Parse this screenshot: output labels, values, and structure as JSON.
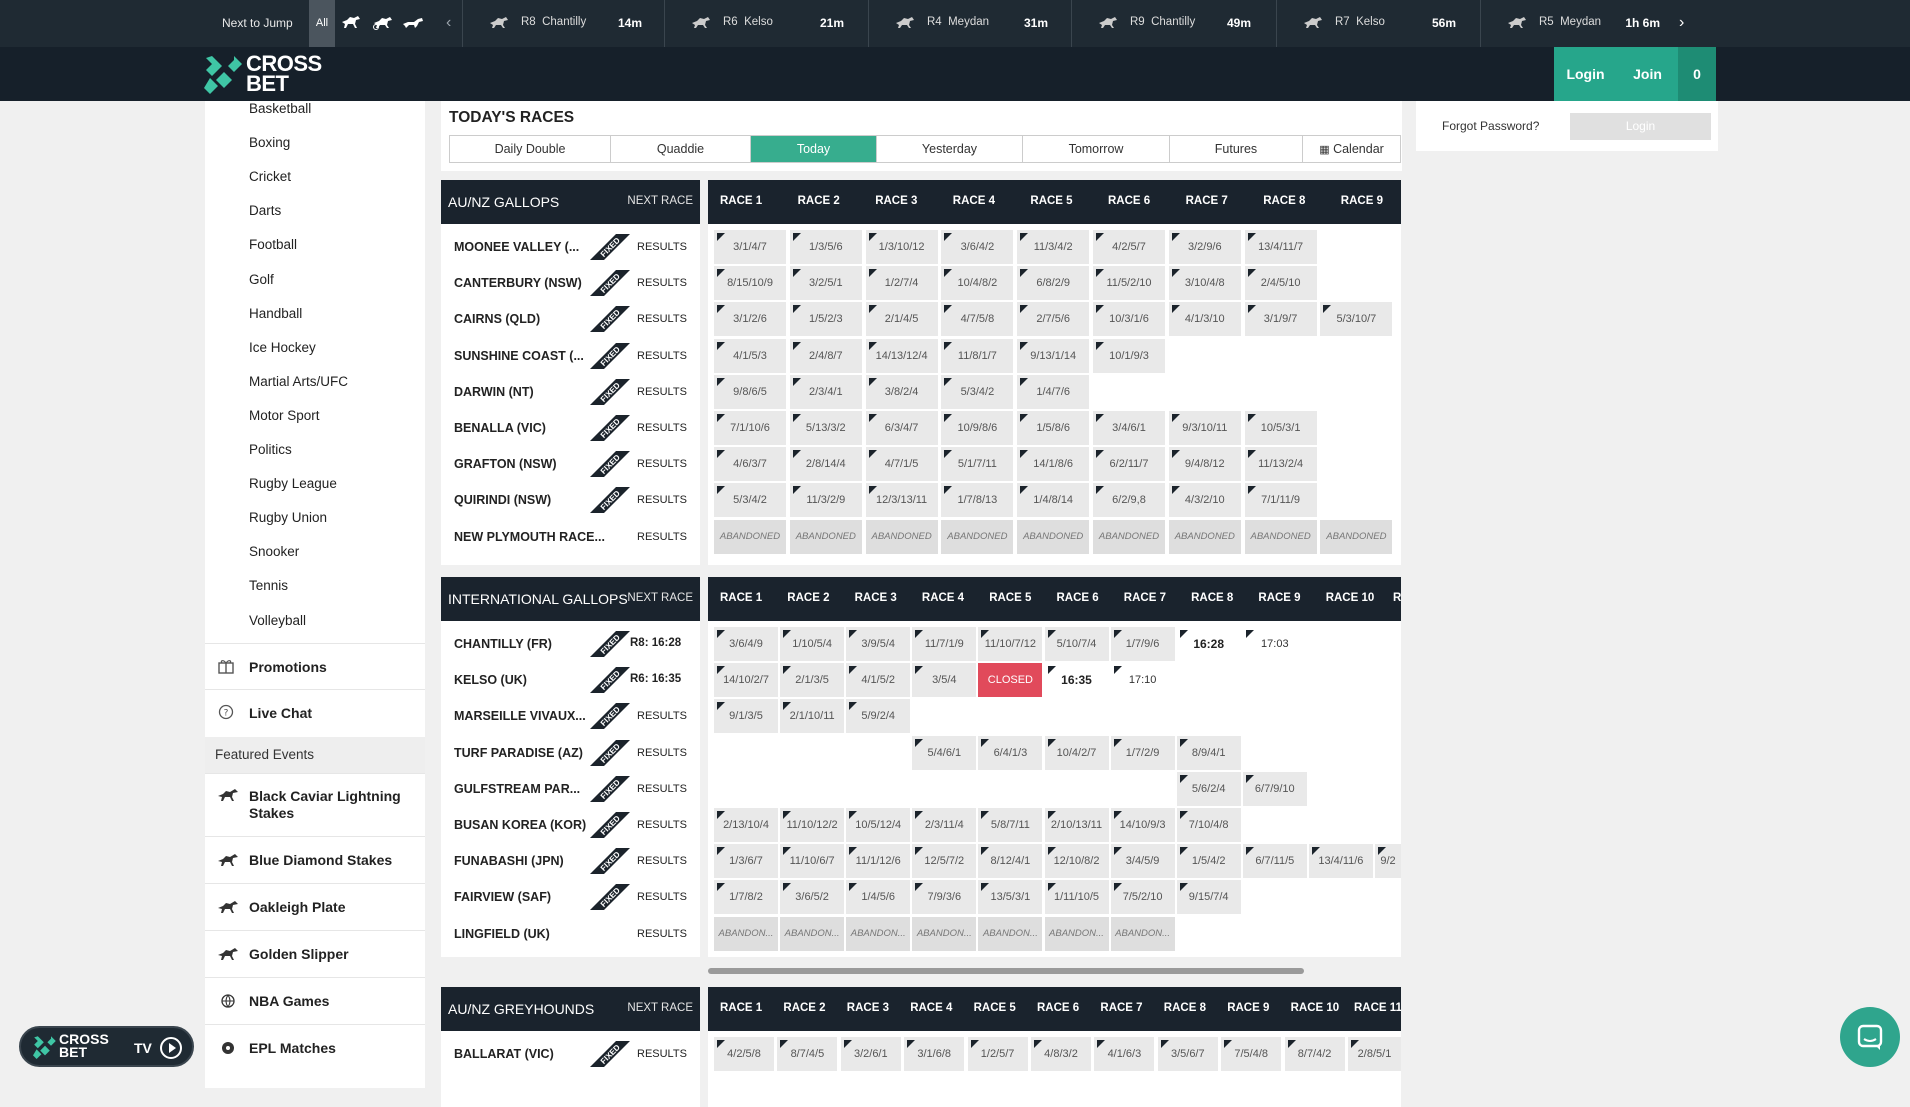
{
  "jumpbar": {
    "next_to_jump": "Next to Jump",
    "all": "All",
    "items": [
      {
        "race": "R8",
        "venue": "Chantilly",
        "time": "14m"
      },
      {
        "race": "R6",
        "venue": "Kelso",
        "time": "21m"
      },
      {
        "race": "R4",
        "venue": "Meydan",
        "time": "31m"
      },
      {
        "race": "R9",
        "venue": "Chantilly",
        "time": "49m"
      },
      {
        "race": "R7",
        "venue": "Kelso",
        "time": "56m"
      },
      {
        "race": "R5",
        "venue": "Meydan",
        "time": "1h 6m"
      }
    ]
  },
  "header": {
    "logo_line1": "CROSS",
    "logo_line2": "BET",
    "login": "Login",
    "join": "Join",
    "bet_count": "0"
  },
  "login_panel": {
    "forgot": "Forgot Password?",
    "login": "Login"
  },
  "sidebar": {
    "sports": [
      "Basketball",
      "Boxing",
      "Cricket",
      "Darts",
      "Football",
      "Golf",
      "Handball",
      "Ice Hockey",
      "Martial Arts/UFC",
      "Motor Sport",
      "Politics",
      "Rugby League",
      "Rugby Union",
      "Snooker",
      "Tennis",
      "Volleyball"
    ],
    "promotions": "Promotions",
    "live_chat": "Live Chat",
    "featured_events": "Featured Events",
    "featured": [
      {
        "label": "Black Caviar Lightning Stakes",
        "icon": "horse-icon"
      },
      {
        "label": "Blue Diamond Stakes",
        "icon": "horse-icon"
      },
      {
        "label": "Oakleigh Plate",
        "icon": "horse-icon"
      },
      {
        "label": "Golden Slipper",
        "icon": "horse-icon"
      },
      {
        "label": "NBA Games",
        "icon": "basketball-icon"
      },
      {
        "label": "EPL Matches",
        "icon": "soccer-ball-icon"
      }
    ]
  },
  "todays_races": {
    "title": "TODAY'S RACES",
    "tabs": [
      "Daily Double",
      "Quaddie",
      "Today",
      "Yesterday",
      "Tomorrow",
      "Futures",
      "Calendar"
    ],
    "active_tab": "Today"
  },
  "sections": [
    {
      "name": "AU/NZ GALLOPS",
      "next_race_label": "NEXT RACE",
      "races": [
        "RACE 1",
        "RACE 2",
        "RACE 3",
        "RACE 4",
        "RACE 5",
        "RACE 6",
        "RACE 7",
        "RACE 8",
        "RACE 9"
      ],
      "rows": [
        {
          "venue": "MOONEE VALLEY (...",
          "fixed": true,
          "next": "RESULTS",
          "cells": [
            "3/1/4/7",
            "1/3/5/6",
            "1/3/10/12",
            "3/6/4/2",
            "11/3/4/2",
            "4/2/5/7",
            "3/2/9/6",
            "13/4/11/7"
          ]
        },
        {
          "venue": "CANTERBURY (NSW)",
          "fixed": true,
          "next": "RESULTS",
          "cells": [
            "8/15/10/9",
            "3/2/5/1",
            "1/2/7/4",
            "10/4/8/2",
            "6/8/2/9",
            "11/5/2/10",
            "3/10/4/8",
            "2/4/5/10"
          ]
        },
        {
          "venue": "CAIRNS (QLD)",
          "fixed": true,
          "next": "RESULTS",
          "cells": [
            "3/1/2/6",
            "1/5/2/3",
            "2/1/4/5",
            "4/7/5/8",
            "2/7/5/6",
            "10/3/1/6",
            "4/1/3/10",
            "3/1/9/7",
            "5/3/10/7"
          ]
        },
        {
          "venue": "SUNSHINE COAST (...",
          "fixed": true,
          "next": "RESULTS",
          "cells": [
            "4/1/5/3",
            "2/4/8/7",
            "14/13/12/4",
            "11/8/1/7",
            "9/13/1/14",
            "10/1/9/3"
          ]
        },
        {
          "venue": "DARWIN (NT)",
          "fixed": true,
          "next": "RESULTS",
          "cells": [
            "9/8/6/5",
            "2/3/4/1",
            "3/8/2/4",
            "5/3/4/2",
            "1/4/7/6"
          ]
        },
        {
          "venue": "BENALLA (VIC)",
          "fixed": true,
          "next": "RESULTS",
          "cells": [
            "7/1/10/6",
            "5/13/3/2",
            "6/3/4/7",
            "10/9/8/6",
            "1/5/8/6",
            "3/4/6/1",
            "9/3/10/11",
            "10/5/3/1"
          ]
        },
        {
          "venue": "GRAFTON (NSW)",
          "fixed": true,
          "next": "RESULTS",
          "cells": [
            "4/6/3/7",
            "2/8/14/4",
            "4/7/1/5",
            "5/1/7/11",
            "14/1/8/6",
            "6/2/11/7",
            "9/4/8/12",
            "11/13/2/4"
          ]
        },
        {
          "venue": "QUIRINDI (NSW)",
          "fixed": true,
          "next": "RESULTS",
          "cells": [
            "5/3/4/2",
            "11/3/2/9",
            "12/3/13/11",
            "1/7/8/13",
            "1/4/8/14",
            "6/2/9,8",
            "4/3/2/10",
            "7/1/11/9"
          ]
        },
        {
          "venue": "NEW PLYMOUTH RACE...",
          "fixed": false,
          "next": "RESULTS",
          "cells": [
            "ABANDONED",
            "ABANDONED",
            "ABANDONED",
            "ABANDONED",
            "ABANDONED",
            "ABANDONED",
            "ABANDONED",
            "ABANDONED",
            "ABANDONED"
          ]
        }
      ]
    },
    {
      "name": "INTERNATIONAL GALLOPS",
      "next_race_label": "NEXT RACE",
      "races": [
        "RACE 1",
        "RACE 2",
        "RACE 3",
        "RACE 4",
        "RACE 5",
        "RACE 6",
        "RACE 7",
        "RACE 8",
        "RACE 9",
        "RACE 10",
        "RA"
      ],
      "rows": [
        {
          "venue": "CHANTILLY (FR)",
          "fixed": true,
          "next": "R8: 16:28",
          "cells": [
            "3/6/4/9",
            "1/10/5/4",
            "3/9/5/4",
            "11/7/1/9",
            "11/10/7/12",
            "5/10/7/4",
            "1/7/9/6",
            "16:28",
            "17:03"
          ]
        },
        {
          "venue": "KELSO (UK)",
          "fixed": true,
          "next": "R6: 16:35",
          "cells": [
            "14/10/2/7",
            "2/1/3/5",
            "4/1/5/2",
            "3/5/4",
            "CLOSED",
            "16:35",
            "17:10"
          ]
        },
        {
          "venue": "MARSEILLE VIVAUX...",
          "fixed": true,
          "next": "RESULTS",
          "cells": [
            "9/1/3/5",
            "2/1/10/11",
            "5/9/2/4"
          ]
        },
        {
          "venue": "TURF PARADISE (AZ)",
          "fixed": true,
          "next": "RESULTS",
          "cells": [
            "",
            "",
            "",
            "5/4/6/1",
            "6/4/1/3",
            "10/4/2/7",
            "1/7/2/9",
            "8/9/4/1"
          ]
        },
        {
          "venue": "GULFSTREAM PAR...",
          "fixed": true,
          "next": "RESULTS",
          "cells": [
            "",
            "",
            "",
            "",
            "",
            "",
            "",
            "5/6/2/4",
            "6/7/9/10"
          ]
        },
        {
          "venue": "BUSAN KOREA (KOR)",
          "fixed": true,
          "next": "RESULTS",
          "cells": [
            "2/13/10/4",
            "11/10/12/2",
            "10/5/12/4",
            "2/3/11/4",
            "5/8/7/11",
            "2/10/13/11",
            "14/10/9/3",
            "7/10/4/8"
          ]
        },
        {
          "venue": "FUNABASHI (JPN)",
          "fixed": true,
          "next": "RESULTS",
          "cells": [
            "1/3/6/7",
            "11/10/6/7",
            "11/1/12/6",
            "12/5/7/2",
            "8/12/4/1",
            "12/10/8/2",
            "3/4/5/9",
            "1/5/4/2",
            "6/7/11/5",
            "13/4/11/6",
            "9/2"
          ]
        },
        {
          "venue": "FAIRVIEW (SAF)",
          "fixed": true,
          "next": "RESULTS",
          "cells": [
            "1/7/8/2",
            "3/6/5/2",
            "1/4/5/6",
            "7/9/3/6",
            "13/5/3/1",
            "1/11/10/5",
            "7/5/2/10",
            "9/15/7/4"
          ]
        },
        {
          "venue": "LINGFIELD (UK)",
          "fixed": false,
          "next": "RESULTS",
          "cells": [
            "ABANDON...",
            "ABANDON...",
            "ABANDON...",
            "ABANDON...",
            "ABANDON...",
            "ABANDON...",
            "ABANDON..."
          ]
        }
      ]
    },
    {
      "name": "AU/NZ GREYHOUNDS",
      "next_race_label": "NEXT RACE",
      "races": [
        "RACE 1",
        "RACE 2",
        "RACE 3",
        "RACE 4",
        "RACE 5",
        "RACE 6",
        "RACE 7",
        "RACE 8",
        "RACE 9",
        "RACE 10",
        "RACE 11"
      ],
      "rows": [
        {
          "venue": "BALLARAT (VIC)",
          "fixed": true,
          "next": "RESULTS",
          "cells": [
            "4/2/5/8",
            "8/7/4/5",
            "3/2/6/1",
            "3/1/6/8",
            "1/2/5/7",
            "4/8/3/2",
            "4/1/6/3",
            "3/5/6/7",
            "7/5/4/8",
            "8/7/4/2",
            "2/8/5/1"
          ]
        }
      ]
    }
  ],
  "fixed_badge": "FIXED",
  "tv": {
    "logo1": "CROSS",
    "logo2": "BET",
    "tv": "TV"
  },
  "colors": {
    "accent": "#37ad8e",
    "header": "#16202a",
    "dark": "#1a232d",
    "closed": "#e14a5b"
  }
}
